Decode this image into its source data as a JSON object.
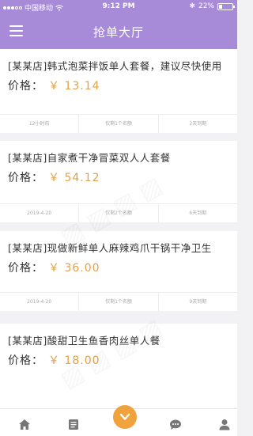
{
  "status_bar": {
    "carrier": "中国移动",
    "time": "9:12 PM",
    "battery": "22%",
    "battery_level": 0.22
  },
  "nav": {
    "title": "抢单大厅"
  },
  "orders": [
    {
      "title": "[某某店]韩式泡菜拌饭单人套餐，建议尽快使用",
      "price_label": "价格：",
      "price": "￥ 13.14",
      "date": "12小时前",
      "remaining": "仅剩1个名额",
      "expiry": "2天到期"
    },
    {
      "title": "[某某店]自家煮干净冒菜双人人套餐",
      "price_label": "价格：",
      "price": "￥ 54.12",
      "date": "2019-4-20",
      "remaining": "仅剩2个名额",
      "expiry": "6天到期"
    },
    {
      "title": "[某某店]现做新鲜单人麻辣鸡爪干锅干净卫生",
      "price_label": "价格：",
      "price": "￥ 36.00",
      "date": "2019-4-20",
      "remaining": "仅剩1个名额",
      "expiry": "9天到期"
    },
    {
      "title": "[某某店]酸甜卫生鱼香肉丝单人餐",
      "price_label": "价格：",
      "price": "￥ 18.00"
    }
  ],
  "tab_bar": {
    "icons": [
      "home-icon",
      "list-icon",
      "grab-order-icon",
      "message-icon",
      "profile-icon"
    ]
  },
  "colors": {
    "primary": "#a78bd9",
    "price": "#e3a14a",
    "accent": "#f0a23d"
  }
}
